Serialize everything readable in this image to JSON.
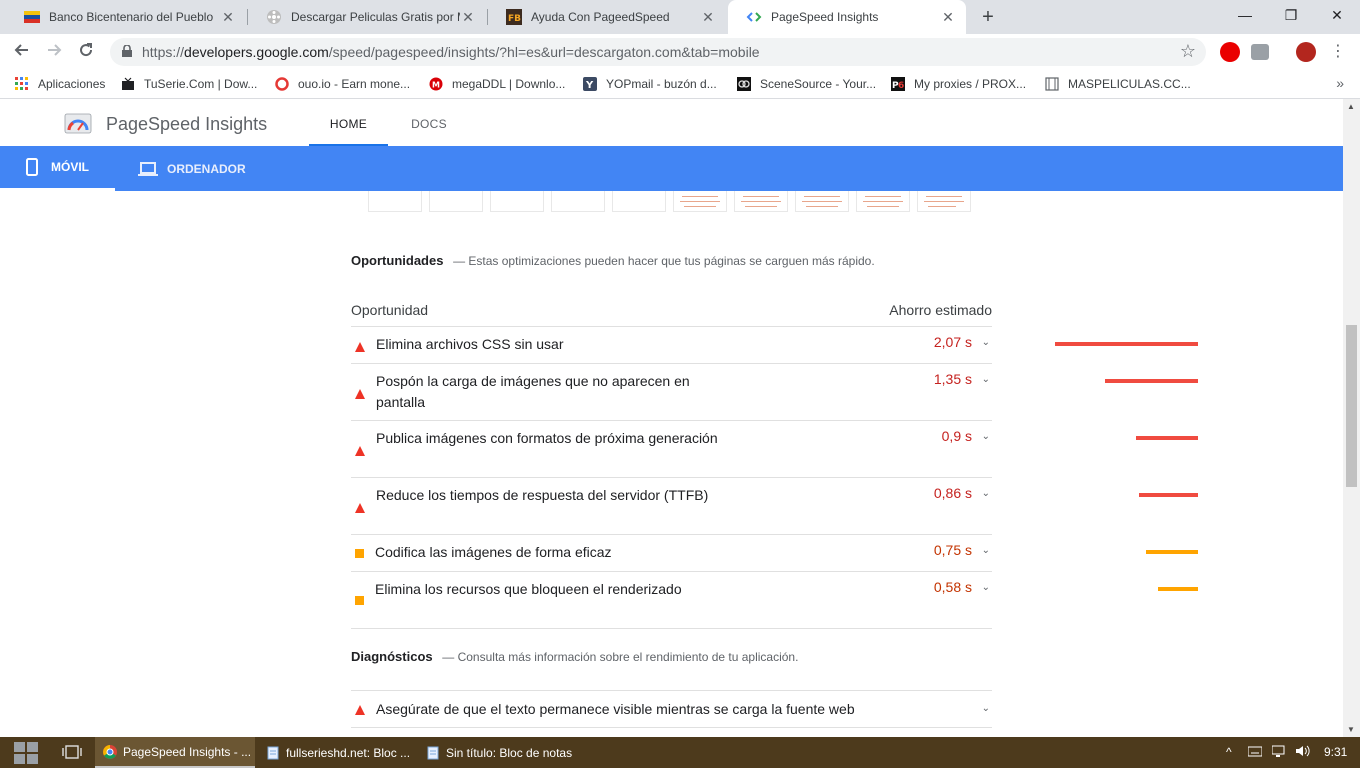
{
  "tabs": [
    {
      "title": "Banco Bicentenario del Pueblo",
      "close": "✕"
    },
    {
      "title": "Descargar Peliculas Gratis por Me",
      "close": "✕"
    },
    {
      "title": "Ayuda Con PageedSpeed",
      "close": "✕"
    },
    {
      "title": "PageSpeed Insights",
      "close": "✕"
    }
  ],
  "new_tab": "+",
  "window_controls": {
    "minimize": "—",
    "restore": "❐",
    "close": "✕"
  },
  "address": {
    "scheme": "https://",
    "host": "developers.google.com",
    "path": "/speed/pagespeed/insights/?hl=es&url=descargaton.com&tab=mobile"
  },
  "bookmarks": [
    {
      "label": "Aplicaciones"
    },
    {
      "label": "TuSerie.Com | Dow..."
    },
    {
      "label": "ouo.io - Earn mone..."
    },
    {
      "label": "megaDDL | Downlo..."
    },
    {
      "label": "YOPmail - buzón d..."
    },
    {
      "label": "SceneSource - Your..."
    },
    {
      "label": "My proxies / PROX..."
    },
    {
      "label": "MASPELICULAS.CC..."
    }
  ],
  "psi": {
    "title": "PageSpeed Insights",
    "nav": {
      "home": "HOME",
      "docs": "DOCS"
    },
    "devices": {
      "mobile": "MÓVIL",
      "desktop": "ORDENADOR"
    }
  },
  "opportunities": {
    "heading": "Oportunidades",
    "description": "— Estas optimizaciones pueden hacer que tus páginas se carguen más rápido.",
    "col_left": "Oportunidad",
    "col_right": "Ahorro estimado",
    "items": [
      {
        "title": "Elimina archivos CSS sin usar",
        "savings": "2,07 s",
        "seconds": 2.07,
        "status": "fail"
      },
      {
        "title": "Pospón la carga de imágenes que no aparecen en pantalla",
        "savings": "1,35 s",
        "seconds": 1.35,
        "status": "fail"
      },
      {
        "title": "Publica imágenes con formatos de próxima generación",
        "savings": "0,9 s",
        "seconds": 0.9,
        "status": "fail"
      },
      {
        "title": "Reduce los tiempos de respuesta del servidor (TTFB)",
        "savings": "0,86 s",
        "seconds": 0.86,
        "status": "fail"
      },
      {
        "title": "Codifica las imágenes de forma eficaz",
        "savings": "0,75 s",
        "seconds": 0.75,
        "status": "average"
      },
      {
        "title": "Elimina los recursos que bloqueen el renderizado",
        "savings": "0,58 s",
        "seconds": 0.58,
        "status": "average"
      }
    ]
  },
  "diagnostics": {
    "heading": "Diagnósticos",
    "description": "— Consulta más información sobre el rendimiento de tu aplicación.",
    "items": [
      {
        "title": "Asegúrate de que el texto permanece visible mientras se carga la fuente web",
        "status": "fail"
      }
    ]
  },
  "taskbar": {
    "apps": [
      {
        "label": "PageSpeed Insights - ..."
      },
      {
        "label": "fullserieshd.net: Bloc ..."
      },
      {
        "label": "Sin título: Bloc de notas"
      }
    ],
    "clock": "9:31"
  },
  "colors": {
    "fail": "#eb0f00",
    "average": "#ffa400",
    "fail_text": "#c5221f",
    "average_text": "#c33300",
    "device_bar": "#4285f4"
  }
}
